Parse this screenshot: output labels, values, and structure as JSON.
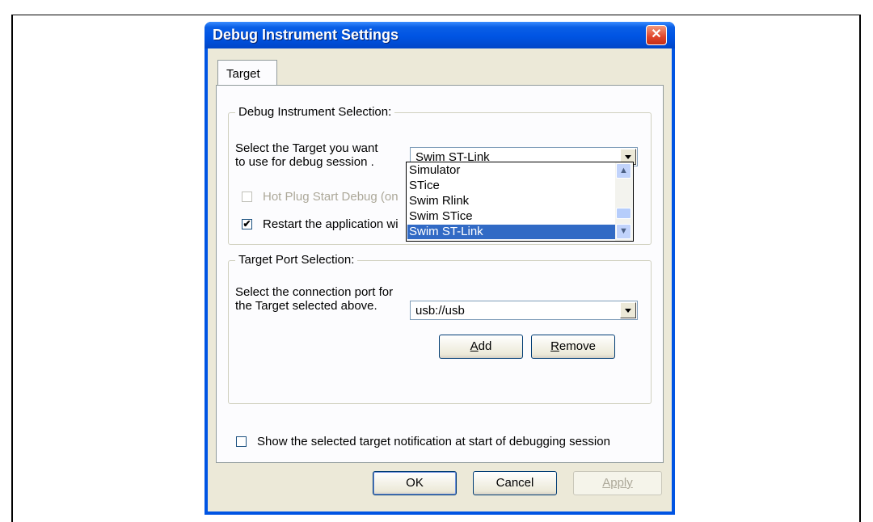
{
  "dialog": {
    "title": "Debug Instrument Settings",
    "close_glyph": "✕"
  },
  "tabs": [
    {
      "label": "Target"
    }
  ],
  "debug_instrument_group": {
    "caption": "Debug Instrument Selection:",
    "target_label_line1": "Select the Target you want",
    "target_label_line2": "to use for debug session .",
    "target_value": "Swim ST-Link",
    "hot_plug_label": "Hot Plug Start Debug (on",
    "hot_plug_checked": false,
    "hot_plug_enabled": false,
    "restart_label": "Restart the application wi",
    "restart_checked": true,
    "dropdown_options": [
      "Simulator",
      "STice",
      "Swim Rlink",
      "Swim STice",
      "Swim ST-Link"
    ],
    "dropdown_selected": "Swim ST-Link"
  },
  "target_port_group": {
    "caption": "Target Port Selection:",
    "port_label_line1": "Select the connection port for",
    "port_label_line2": "the Target selected above.",
    "port_value": "usb://usb",
    "add_button": {
      "mnemonic": "A",
      "rest": "dd"
    },
    "remove_button": {
      "mnemonic": "R",
      "rest": "emove"
    }
  },
  "notification_checkbox": {
    "label": "Show the selected target notification at start of debugging session",
    "checked": false
  },
  "footer": {
    "ok_label": "OK",
    "cancel_label": "Cancel",
    "apply_label": "Apply"
  },
  "icons": {
    "check_glyph": "✔",
    "scroll_up_glyph": "▲",
    "scroll_down_glyph": "▼"
  }
}
